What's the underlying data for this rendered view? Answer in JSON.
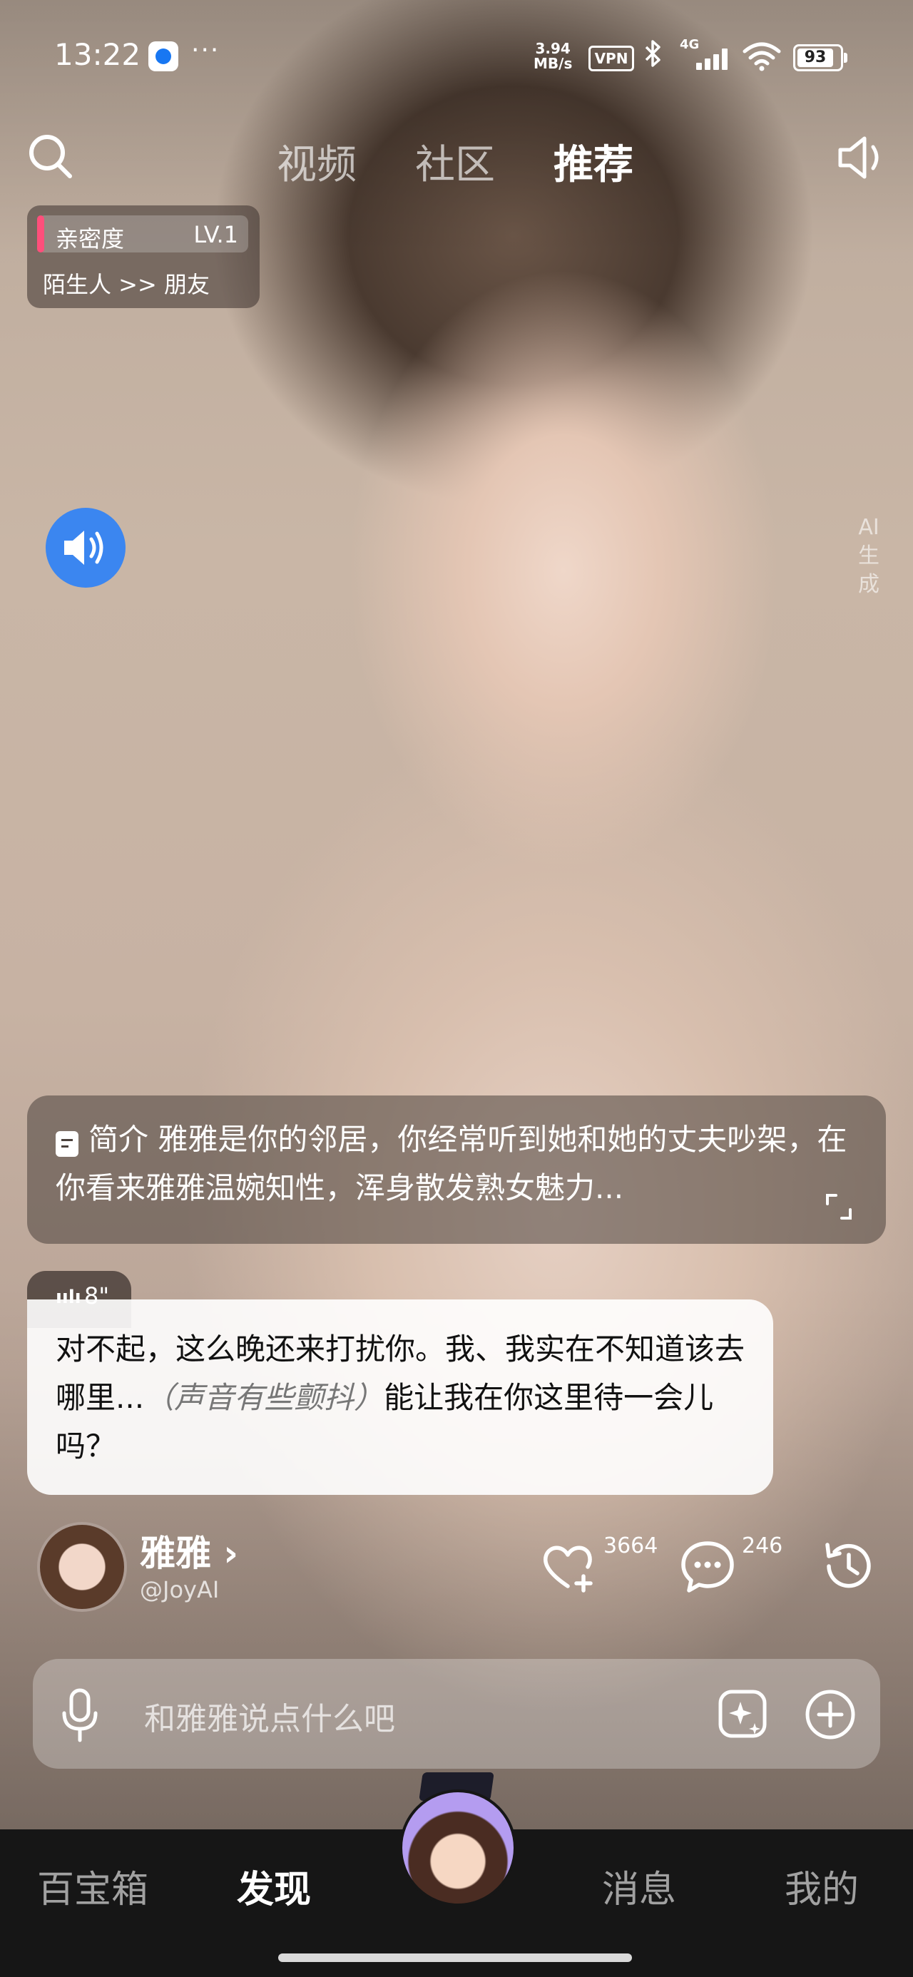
{
  "status_bar": {
    "time": "13:22",
    "more": "···",
    "net_speed_value": "3.94",
    "net_speed_unit": "MB/s",
    "vpn": "VPN",
    "network": "4G",
    "battery": "93",
    "icons": [
      "app-notification-icon",
      "bluetooth-icon",
      "signal-icon",
      "wifi-icon",
      "battery-icon"
    ]
  },
  "top_nav": {
    "tabs": [
      {
        "label": "视频",
        "active": false
      },
      {
        "label": "社区",
        "active": false
      },
      {
        "label": "推荐",
        "active": true
      }
    ],
    "icons": [
      "search-icon",
      "sound-icon"
    ]
  },
  "intimacy": {
    "label": "亲密度",
    "level": "LV.1",
    "relation": "陌生人 >> 朋友",
    "accent": "#ff4f7b"
  },
  "ai_tag": [
    "AI",
    "生",
    "成"
  ],
  "intro": {
    "text": "简介 雅雅是你的邻居，你经常听到她和她的丈夫吵架，在你看来雅雅温婉知性，浑身散发熟女魅力..."
  },
  "message": {
    "voice_duration": "8\"",
    "text_before": "对不起，这么晚还来打扰你。我、我实在不知道该去哪里...",
    "action_text": "（声音有些颤抖）",
    "text_after": "能让我在你这里待一会儿吗？"
  },
  "profile": {
    "name": "雅雅",
    "chevron": "›",
    "handle": "@JoyAI",
    "likes": "3664",
    "comments": "246"
  },
  "input": {
    "placeholder": "和雅雅说点什么吧"
  },
  "bottom_nav": {
    "items": [
      {
        "label": "百宝箱",
        "active": false
      },
      {
        "label": "发现",
        "active": true
      },
      {
        "label": "消息",
        "active": false
      },
      {
        "label": "我的",
        "active": false
      }
    ]
  },
  "colors": {
    "voice_button": "#3b86f0",
    "nav_background": "#161616"
  }
}
